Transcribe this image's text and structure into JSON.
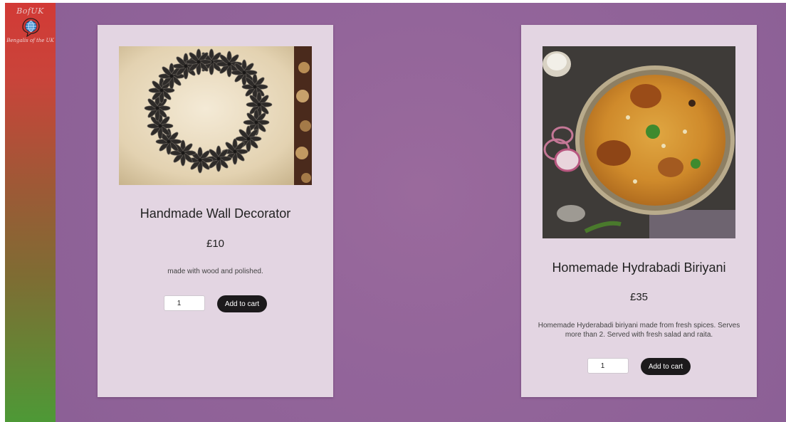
{
  "brand": {
    "title": "BofUK",
    "subtitle": "Bengalis of the UK"
  },
  "products": [
    {
      "title": "Handmade Wall Decorator",
      "price": "£10",
      "description": "made with wood and polished.",
      "quantity": "1",
      "button_label": "Add to cart"
    },
    {
      "title": "Homemade Hydrabadi Biriyani",
      "price": "£35",
      "description": "Homemade Hyderabadi biriyani made from fresh spices. Serves more than 2. Served with fresh salad and raita.",
      "quantity": "1",
      "button_label": "Add to cart"
    }
  ],
  "colors": {
    "background": "#93659a",
    "card": "#e3d5e2",
    "button": "#1c1a1c",
    "sidebar_top": "#d23a36",
    "sidebar_bottom": "#4d9936"
  }
}
